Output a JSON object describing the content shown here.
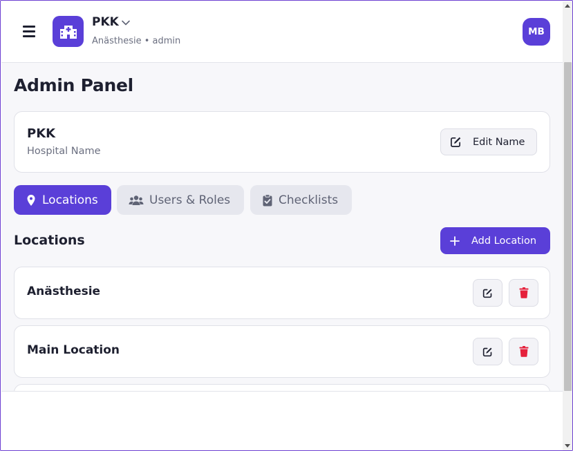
{
  "header": {
    "hospital": "PKK",
    "subtitle": "Anästhesie • admin",
    "avatar_initials": "MB"
  },
  "page_title": "Admin Panel",
  "hospital_card": {
    "name": "PKK",
    "label": "Hospital Name",
    "edit_button": "Edit Name"
  },
  "tabs": [
    {
      "label": "Locations",
      "icon": "location-pin-icon",
      "active": true
    },
    {
      "label": "Users & Roles",
      "icon": "users-icon",
      "active": false
    },
    {
      "label": "Checklists",
      "icon": "clipboard-check-icon",
      "active": false
    }
  ],
  "locations": {
    "title": "Locations",
    "add_button": "Add Location",
    "items": [
      {
        "name": "Anästhesie"
      },
      {
        "name": "Main Location"
      }
    ]
  },
  "colors": {
    "accent": "#5a3fd8",
    "danger": "#e5213c",
    "background": "#f7f7fa"
  }
}
